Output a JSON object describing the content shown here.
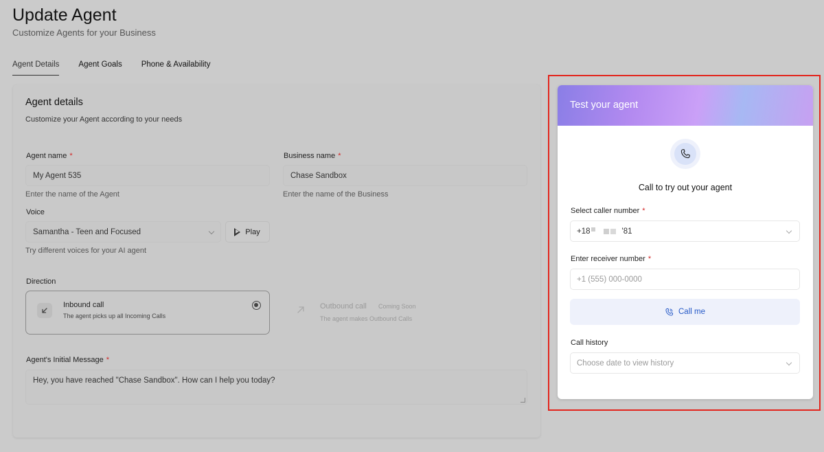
{
  "header": {
    "title": "Update Agent",
    "subtitle": "Customize Agents for your Business"
  },
  "tabs": [
    {
      "label": "Agent Details",
      "active": true
    },
    {
      "label": "Agent Goals",
      "active": false
    },
    {
      "label": "Phone & Availability",
      "active": false
    }
  ],
  "form": {
    "section_title": "Agent details",
    "section_desc": "Customize your Agent according to your needs",
    "agent_name": {
      "label": "Agent name",
      "required": "*",
      "value": "My Agent 535",
      "help": "Enter the name of the Agent"
    },
    "business_name": {
      "label": "Business name",
      "required": "*",
      "value": "Chase Sandbox",
      "help": "Enter the name of the Business"
    },
    "voice": {
      "label": "Voice",
      "value": "Samantha - Teen and Focused",
      "play_label": "Play",
      "help": "Try different voices for your AI agent"
    },
    "direction": {
      "label": "Direction",
      "inbound": {
        "title": "Inbound call",
        "desc": "The agent picks up all Incoming Calls",
        "selected": true
      },
      "outbound": {
        "title": "Outbound call",
        "badge": "Coming Soon",
        "desc": "The agent makes Outbound Calls"
      }
    },
    "initial_message": {
      "label": "Agent's Initial Message",
      "required": "*",
      "value": "Hey, you have reached \"Chase Sandbox\". How can I help you today?"
    }
  },
  "test_panel": {
    "title": "Test your agent",
    "call_title": "Call to try out your agent",
    "caller_label": "Select caller number",
    "caller_required": "*",
    "caller_prefix": "+18",
    "caller_suffix": "'81",
    "receiver_label": "Enter receiver number",
    "receiver_required": "*",
    "receiver_placeholder": "+1 (555) 000-0000",
    "call_button": "Call me",
    "history_label": "Call history",
    "history_placeholder": "Choose date to view history"
  },
  "colors": {
    "accent_blue": "#2559c7",
    "required_red": "#d32727",
    "highlight_red": "#e3241c"
  }
}
